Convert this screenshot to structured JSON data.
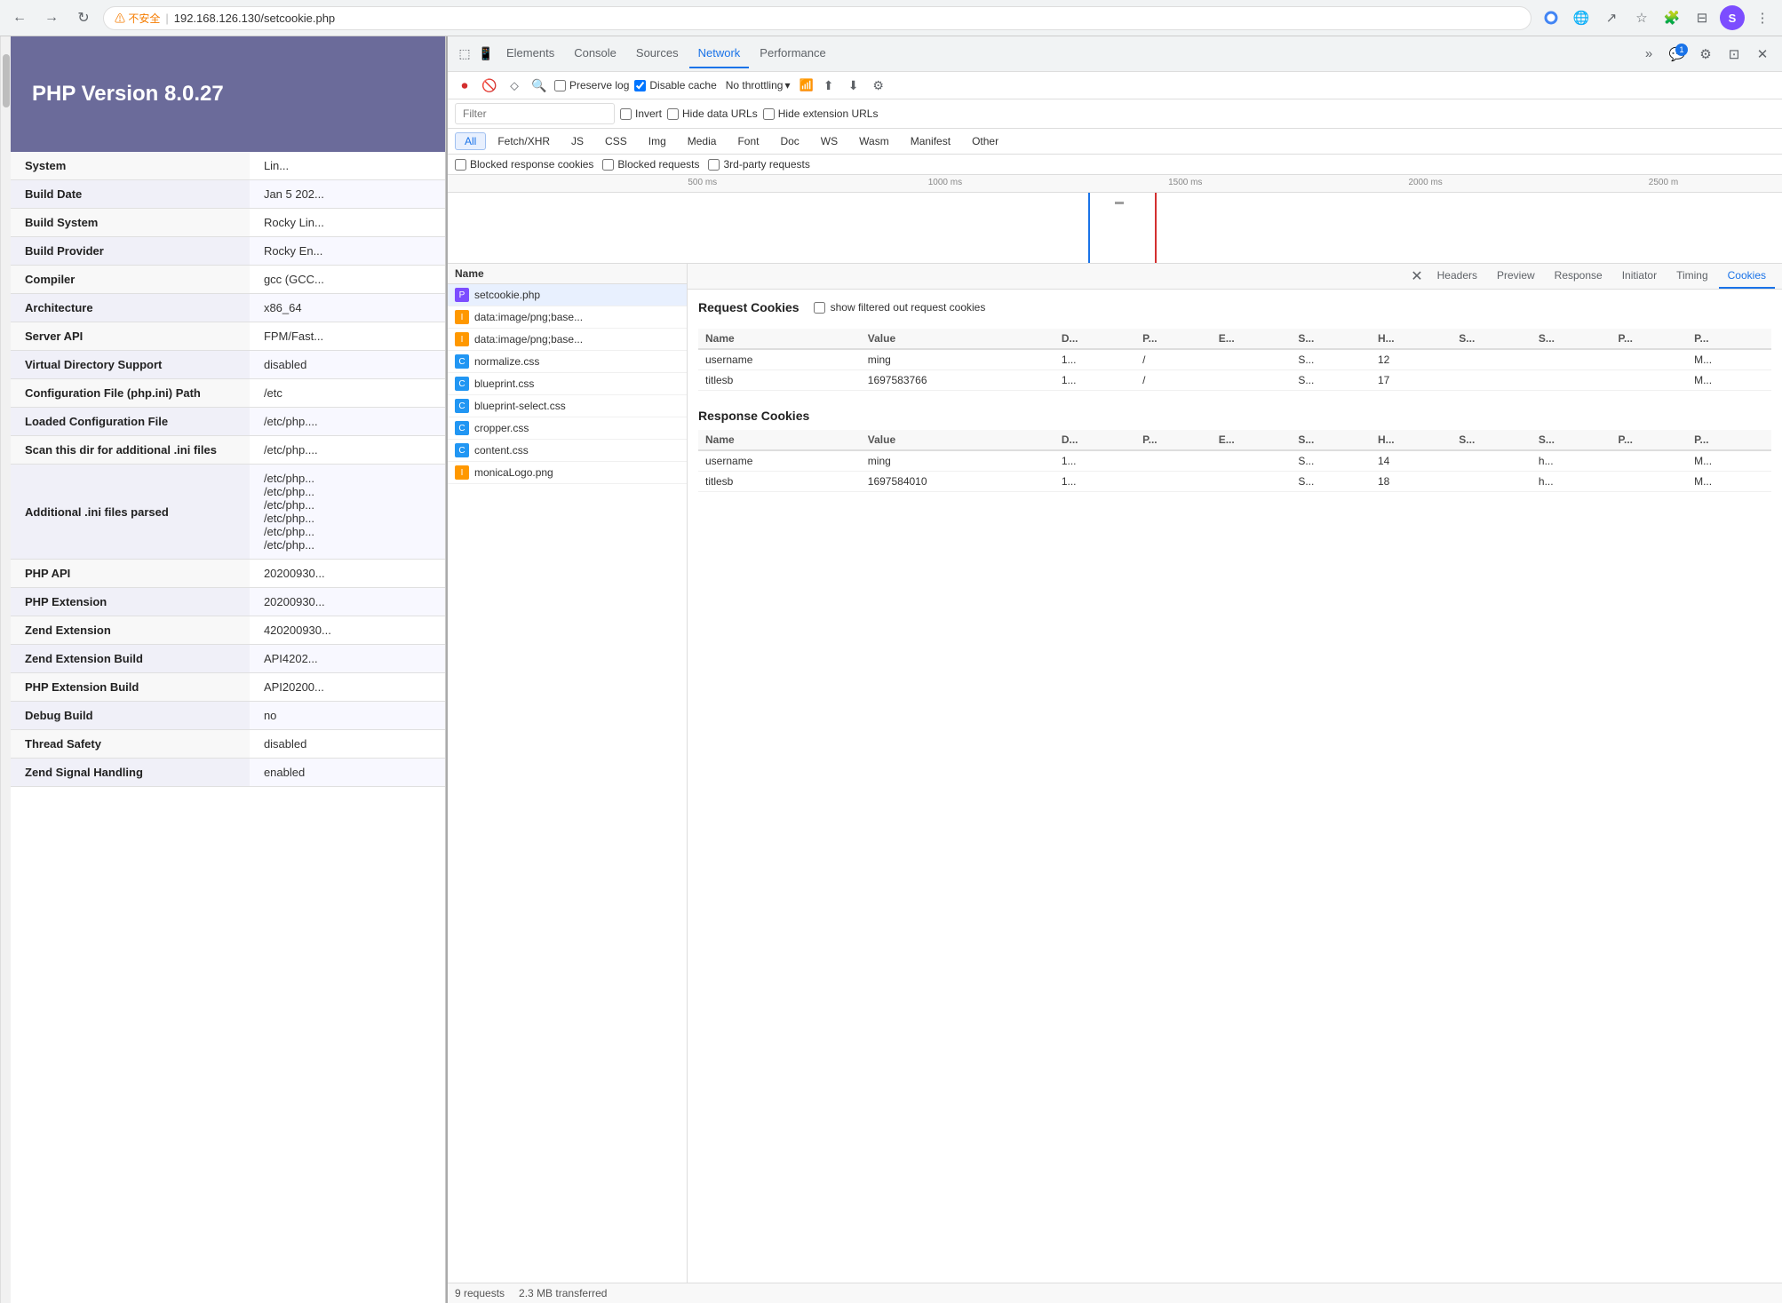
{
  "browser": {
    "back_btn": "←",
    "forward_btn": "→",
    "refresh_btn": "↻",
    "warning_text": "⚠ 不安全",
    "url": "192.168.126.130/setcookie.php",
    "tab_title": "PHP Version 8.0.27",
    "avatar_initials": "S",
    "more_icon": "⋮"
  },
  "page": {
    "php_version_title": "PHP Version 8.0.27",
    "table_rows": [
      {
        "label": "System",
        "value": "Lin..."
      },
      {
        "label": "Build Date",
        "value": "Jan 5 202..."
      },
      {
        "label": "Build System",
        "value": "Rocky Lin..."
      },
      {
        "label": "Build Provider",
        "value": "Rocky En..."
      },
      {
        "label": "Compiler",
        "value": "gcc (GCC..."
      },
      {
        "label": "Architecture",
        "value": "x86_64"
      },
      {
        "label": "Server API",
        "value": "FPM/Fast..."
      },
      {
        "label": "Virtual Directory Support",
        "value": "disabled"
      },
      {
        "label": "Configuration File (php.ini) Path",
        "value": "/etc"
      },
      {
        "label": "Loaded Configuration File",
        "value": "/etc/php...."
      },
      {
        "label": "Scan this dir for additional .ini files",
        "value": "/etc/php...."
      },
      {
        "label": "Additional .ini files parsed",
        "value": "/etc/php...\n/etc/php...\n/etc/php...\n/etc/php...\n/etc/php...\n/etc/php..."
      },
      {
        "label": "PHP API",
        "value": "20200930..."
      },
      {
        "label": "PHP Extension",
        "value": "20200930..."
      },
      {
        "label": "Zend Extension",
        "value": "420200930..."
      },
      {
        "label": "Zend Extension Build",
        "value": "API4202..."
      },
      {
        "label": "PHP Extension Build",
        "value": "API20200..."
      },
      {
        "label": "Debug Build",
        "value": "no"
      },
      {
        "label": "Thread Safety",
        "value": "disabled"
      },
      {
        "label": "Zend Signal Handling",
        "value": "enabled"
      }
    ]
  },
  "devtools": {
    "tabs": [
      "Elements",
      "Console",
      "Sources",
      "Network",
      "Performance"
    ],
    "active_tab": "Network",
    "more_btn": "»",
    "chat_badge": "1",
    "settings_icon": "⚙",
    "close_icon": "✕",
    "undock_icon": "⊡",
    "device_icon": "📱",
    "inspect_icon": "⬚",
    "cursor_icon": "✥"
  },
  "network": {
    "record_btn": "⏺",
    "clear_btn": "🚫",
    "filter_icon": "⬦",
    "search_icon": "🔍",
    "filter_placeholder": "Filter",
    "preserve_log_label": "Preserve log",
    "disable_cache_label": "Disable cache",
    "disable_cache_checked": true,
    "no_throttling_label": "No throttling",
    "invert_label": "Invert",
    "hide_data_urls_label": "Hide data URLs",
    "hide_extension_urls_label": "Hide extension URLs",
    "filter_types": [
      "All",
      "Fetch/XHR",
      "JS",
      "CSS",
      "Img",
      "Media",
      "Font",
      "Doc",
      "WS",
      "Wasm",
      "Manifest",
      "Other"
    ],
    "active_filter": "All",
    "blocked_response_cookies": "Blocked response cookies",
    "blocked_requests": "Blocked requests",
    "third_party_requests": "3rd-party requests",
    "timeline_marks": [
      "500 ms",
      "1000 ms",
      "1500 ms",
      "2000 ms",
      "2500 m"
    ],
    "timeline_blue_pos": "48%",
    "timeline_red_pos": "55%",
    "files": [
      {
        "name": "setcookie.php",
        "icon_type": "php",
        "icon_text": "P",
        "selected": true
      },
      {
        "name": "data:image/png;base...",
        "icon_type": "png",
        "icon_text": "I"
      },
      {
        "name": "data:image/png;base...",
        "icon_type": "png",
        "icon_text": "I"
      },
      {
        "name": "normalize.css",
        "icon_type": "css",
        "icon_text": "C"
      },
      {
        "name": "blueprint.css",
        "icon_type": "css",
        "icon_text": "C"
      },
      {
        "name": "blueprint-select.css",
        "icon_type": "css",
        "icon_text": "C"
      },
      {
        "name": "cropper.css",
        "icon_type": "css",
        "icon_text": "C"
      },
      {
        "name": "content.css",
        "icon_type": "css",
        "icon_text": "C"
      },
      {
        "name": "monicaLogo.png",
        "icon_type": "png",
        "icon_text": "I"
      }
    ],
    "file_list_header": "Name",
    "status_bar": {
      "requests": "9 requests",
      "transferred": "2.3 MB transferred"
    }
  },
  "detail": {
    "tabs": [
      "Headers",
      "Preview",
      "Response",
      "Initiator",
      "Timing",
      "Cookies"
    ],
    "active_tab": "Cookies",
    "close_icon": "✕",
    "request_cookies_title": "Request Cookies",
    "show_filtered_label": "show filtered out request cookies",
    "request_cookies_cols": [
      "Name",
      "Value",
      "D...",
      "P...",
      "E...",
      "S...",
      "H...",
      "S...",
      "S...",
      "P...",
      "P..."
    ],
    "request_cookies": [
      {
        "name": "username",
        "value": "ming",
        "d": "1...",
        "p": "/",
        "e": "",
        "s": "S...",
        "h": "12",
        "s2": "",
        "s3": "",
        "p2": "",
        "p3": "M..."
      },
      {
        "name": "titlesb",
        "value": "1697583766",
        "d": "1...",
        "p": "/",
        "e": "",
        "s": "S...",
        "h": "17",
        "s2": "",
        "s3": "",
        "p2": "",
        "p3": "M..."
      }
    ],
    "response_cookies_title": "Response Cookies",
    "response_cookies_cols": [
      "Name",
      "Value",
      "D...",
      "P...",
      "E...",
      "S...",
      "H...",
      "S...",
      "S...",
      "P...",
      "P..."
    ],
    "response_cookies": [
      {
        "name": "username",
        "value": "ming",
        "d": "1...",
        "p": "",
        "e": "",
        "s": "S...",
        "h": "14",
        "s2": "",
        "s3": "h...",
        "p2": "",
        "p3": "M..."
      },
      {
        "name": "titlesb",
        "value": "1697584010",
        "d": "1...",
        "p": "",
        "e": "",
        "s": "S...",
        "h": "18",
        "s2": "",
        "s3": "h...",
        "p2": "",
        "p3": "M..."
      }
    ]
  }
}
